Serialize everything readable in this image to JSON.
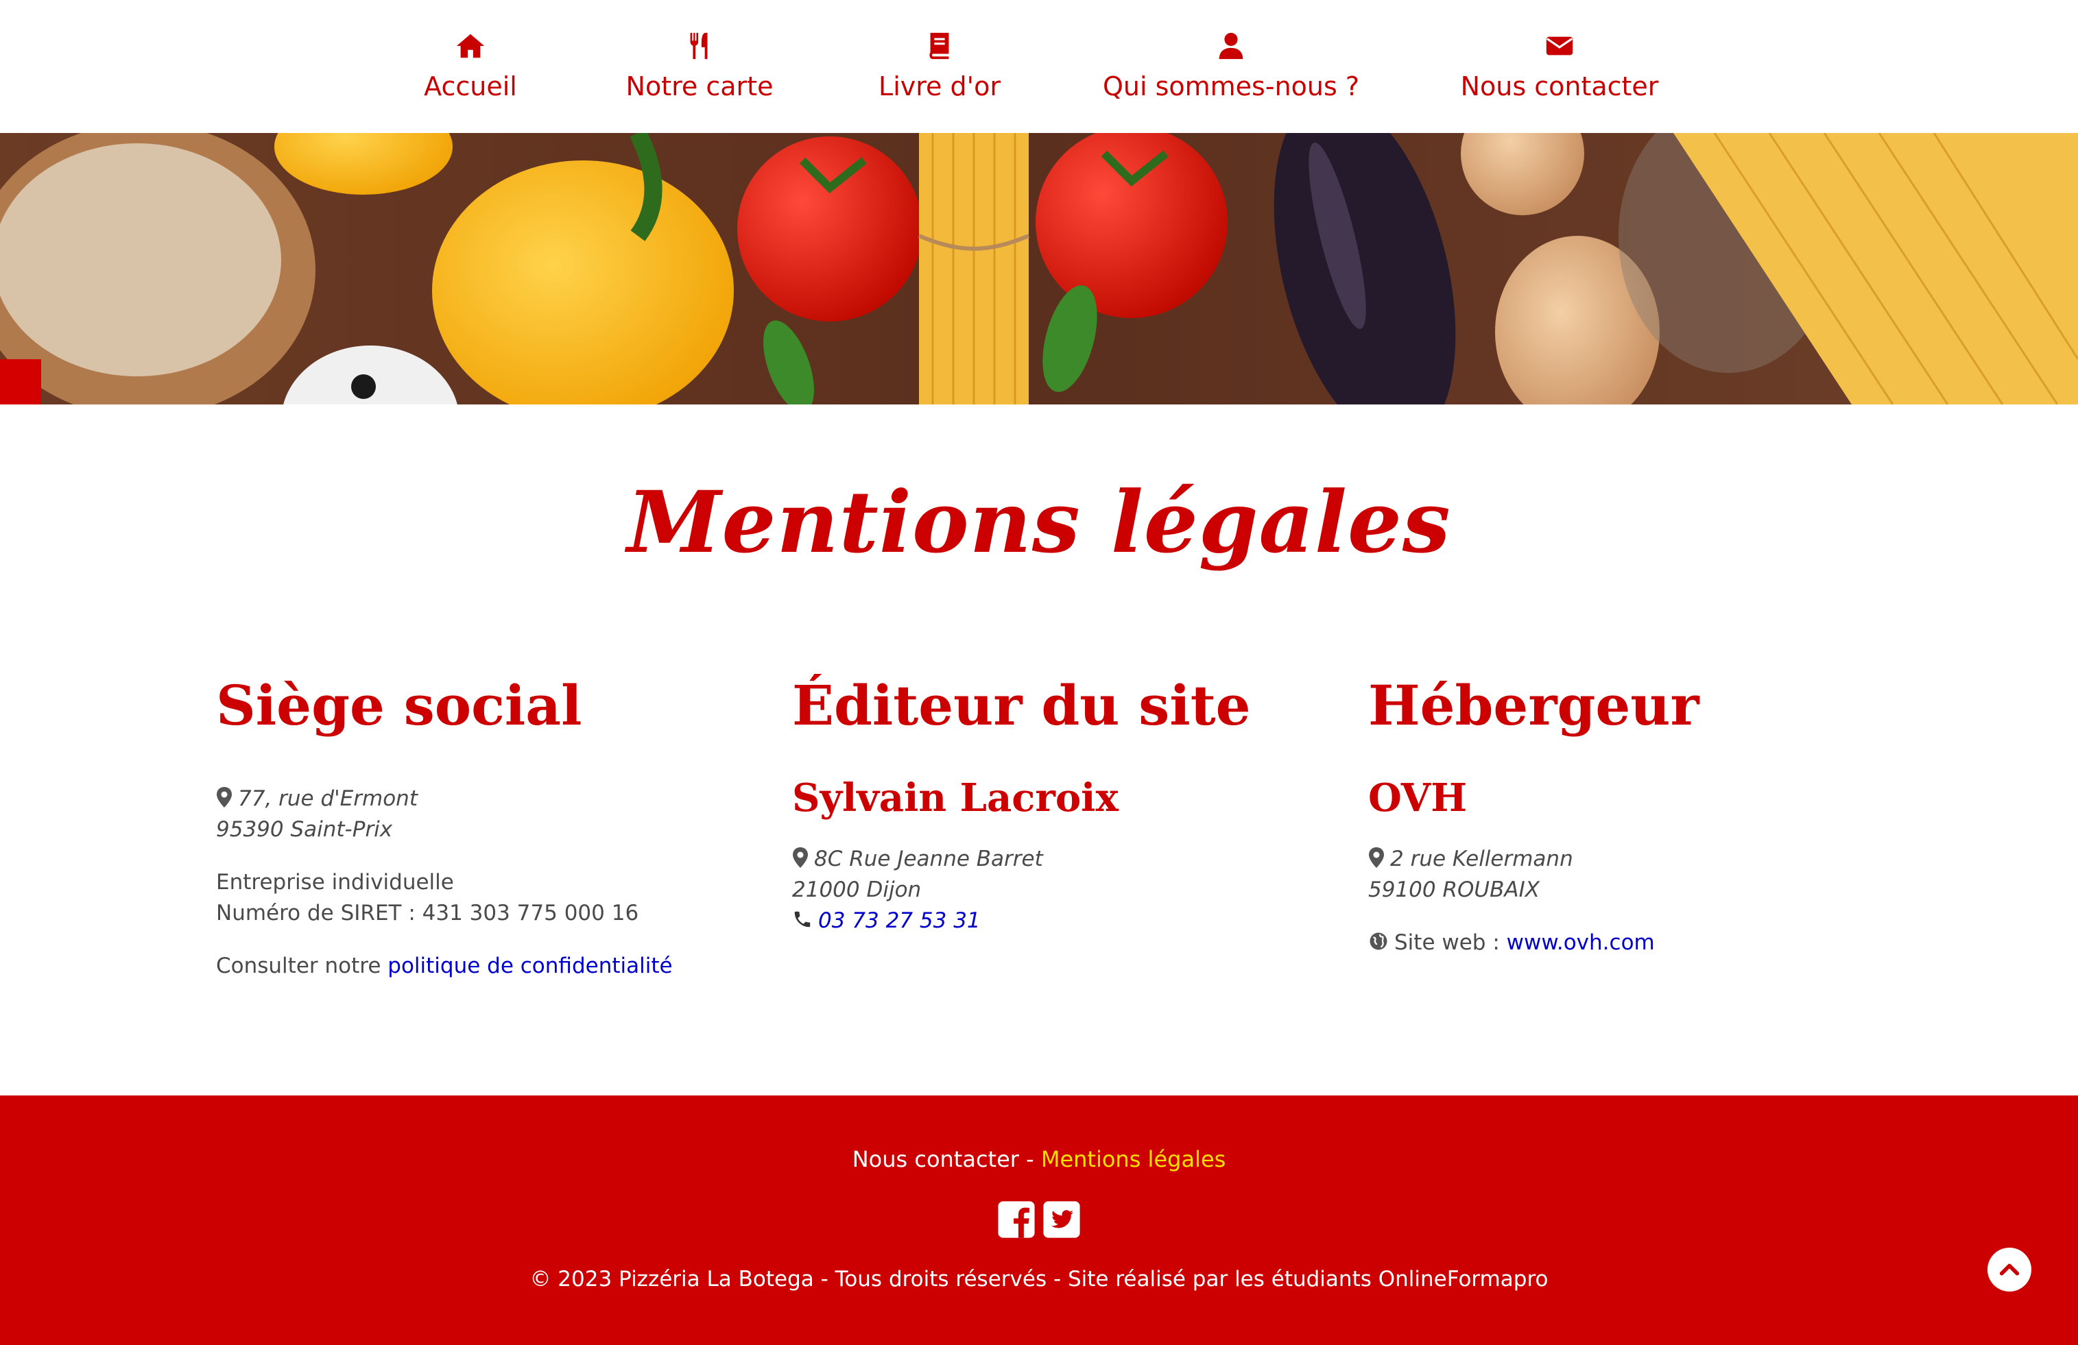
{
  "nav": {
    "items": [
      {
        "label": "Accueil",
        "icon": "home-icon"
      },
      {
        "label": "Notre carte",
        "icon": "fork-knife-icon"
      },
      {
        "label": "Livre d'or",
        "icon": "book-icon"
      },
      {
        "label": "Qui sommes-nous ?",
        "icon": "user-icon"
      },
      {
        "label": "Nous contacter",
        "icon": "envelope-icon"
      }
    ]
  },
  "banner": {
    "image": "vegetables-pasta-banner"
  },
  "page": {
    "title": "Mentions légales"
  },
  "siege": {
    "heading": "Siège social",
    "address1": "77, rue d'Ermont",
    "address2": "95390 Saint-Prix",
    "type": "Entreprise individuelle",
    "siret": "Numéro de SIRET : 431 303 775 000 16",
    "consult": "Consulter notre ",
    "privacy_link": "politique de confidentialité"
  },
  "editeur": {
    "heading": "Éditeur du site",
    "name": "Sylvain Lacroix",
    "address1": "8C Rue Jeanne Barret",
    "address2": "21000 Dijon",
    "phone": "03 73 27 53 31"
  },
  "hebergeur": {
    "heading": "Hébergeur",
    "name": "OVH",
    "address1": "2 rue Kellermann",
    "address2": "59100 ROUBAIX",
    "site_label": "Site web : ",
    "site_link": "www.ovh.com"
  },
  "footer": {
    "contact": "Nous contacter",
    "separator": " - ",
    "legal": "Mentions légales",
    "copyright": "© 2023 Pizzéria La Botega - Tous droits réservés - Site réalisé par les étudiants OnlineFormapro"
  },
  "colors": {
    "brand_red": "#cc0000",
    "footer_active": "#ffe000",
    "link_blue": "#0000cc"
  }
}
